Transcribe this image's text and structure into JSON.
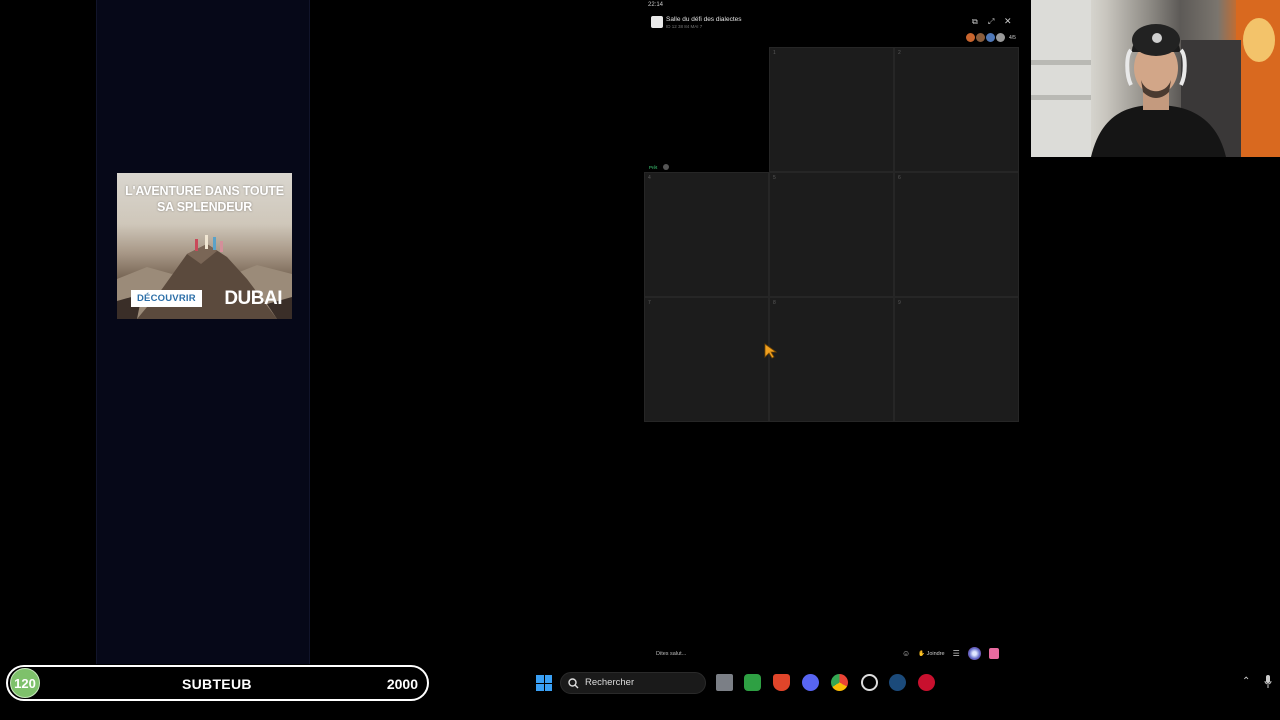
{
  "status": {
    "time": "22:14"
  },
  "ad": {
    "headline": "L'AVENTURE DANS TOUTE SA SPLENDEUR",
    "cta": "DÉCOUVRIR",
    "brand": "DUBAI"
  },
  "game": {
    "room_title": "Salle du défi des dialectes",
    "room_subtitle": "ID 12 38 84 MAI 7",
    "players_count": "4/5",
    "tag_label": "Prêt",
    "chat_placeholder": "Dites salut...",
    "join_label": "Joindre",
    "cells": [
      "1",
      "2",
      "4",
      "5",
      "6",
      "7",
      "8",
      "9"
    ]
  },
  "overlay": {
    "count": "120",
    "label": "SUBTEUB",
    "goal": "2000"
  },
  "taskbar": {
    "search_placeholder": "Rechercher",
    "apps": [
      "file-explorer-icon",
      "spreadsheet-icon",
      "brave-icon",
      "discord-icon",
      "chrome-icon",
      "settings-icon",
      "steam-icon",
      "media-icon"
    ]
  },
  "colors": {
    "left_panel": "#060818",
    "grid_cell": "#1c1c1c",
    "subbar_count": "#7ec16b",
    "windows_blue": "#3aa0f5"
  }
}
